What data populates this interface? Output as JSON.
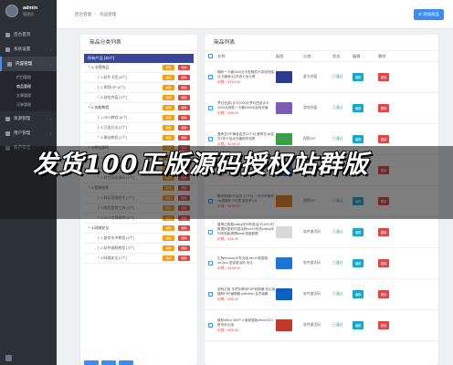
{
  "sidebar": {
    "user": {
      "name": "admin",
      "role": "管理员"
    },
    "items": [
      {
        "label": "后台首页",
        "icon": "home-icon",
        "chev": "",
        "active": false
      },
      {
        "label": "系统设置",
        "icon": "settings-icon",
        "chev": "‹",
        "active": false
      },
      {
        "label": "内容管理",
        "icon": "list-icon",
        "chev": "‹",
        "active": true
      },
      {
        "label": "资源管理",
        "icon": "folder-icon",
        "chev": "‹",
        "active": false
      },
      {
        "label": "用户管理",
        "icon": "user-icon",
        "chev": "‹",
        "active": false
      },
      {
        "label": "账户安全",
        "icon": "shield-icon",
        "chev": "‹",
        "active": false
      }
    ],
    "subitems": [
      "栏目管理",
      "商品管理",
      "文章管理",
      "订单管理"
    ]
  },
  "topbar": {
    "crumbs": [
      "后台管理",
      "/",
      "商品管理"
    ],
    "button": "添加商品"
  },
  "left_panel": {
    "title": "商品分类列表",
    "header": "所有产品 [45个]",
    "edit_label": "编辑",
    "delete_label": "删除",
    "rows": [
      {
        "name": "└ 1.卡密商品",
        "level": 1
      },
      {
        "name": "├ 1.软件卡密 [8个]",
        "level": 2
      },
      {
        "name": "├ 2.视频VIP [4个]",
        "level": 2
      },
      {
        "name": "└ 3.游戏充值 [3个]",
        "level": 2
      },
      {
        "name": "└ 2.技能教程",
        "level": 1
      },
      {
        "name": "├ 1.SEO教程 [6个]",
        "level": 2
      },
      {
        "name": "├ 2.引流方法 [5个]",
        "level": 2
      },
      {
        "name": "└ 3.建站教程 [4个]",
        "level": 2
      },
      {
        "name": "└ 3.网站源码",
        "level": 1
      },
      {
        "name": "├ 1.企业网站源码 [5个]",
        "level": 2
      },
      {
        "name": "├ 2.商城网站源码 [3个]",
        "level": 2
      },
      {
        "name": "└ 3.其它网站源码 [2个]",
        "level": 2
      },
      {
        "name": "└ 3.营销软件",
        "level": 1
      },
      {
        "name": "├ 1.群发营销软件 [4个]",
        "level": 2
      },
      {
        "name": "├ 2.微信营销工具 [3个]",
        "level": 2
      },
      {
        "name": "└ 3.SEO工具软件 [2个]",
        "level": 2
      },
      {
        "name": "└ 4.网络安全",
        "level": 1
      },
      {
        "name": "├ 1.查杀技术教程 [4个]",
        "level": 2
      },
      {
        "name": "├ 2.软件破解教程 [3个]",
        "level": 2
      },
      {
        "name": "└ 3.网络安全 [2个]",
        "level": 2
      }
    ]
  },
  "right_panel": {
    "title": "商品列表",
    "columns": [
      "",
      "名称",
      "配图",
      "分类",
      "状态",
      "编辑",
      "删除"
    ],
    "edit_label": "编辑",
    "delete_label": "删除",
    "rows": [
      {
        "title": "随机一卡通1000元卡密随机卡游戏充值点卡通用QQ币游卡永久等",
        "price": "价格：¥910.00",
        "category": "虚卡充值",
        "status": "已通过",
        "thumb": "#2c3b8f"
      },
      {
        "title": "梦幻西游2点卡1000元梦幻西游点卡1000点网易一卡通1000元游戏充值",
        "price": "价格：¥98.00",
        "category": "游戏充值",
        "status": "已通过",
        "thumb": "#7b5bb5"
      },
      {
        "title": "爱奇艺VIP黄金会员12个月 爱奇艺vip会员1年卡自动充值即时到账",
        "price": "价格：¥148.00",
        "category": "视频VIP",
        "status": "已通过",
        "thumb": "#3b9e4a"
      },
      {
        "title": "优酷视频VIP年卡 优酷VIP会员12个月 自动充值",
        "price": "价格：¥158.00",
        "category": "视频VIP",
        "status": "已通过",
        "thumb": "#2a7ad8"
      },
      {
        "title": "腾讯视频VIP会员 12个月 一年卡好莱坞vip视频年卡年费 直充秒QQ",
        "price": "价格：¥190.00",
        "category": "视频VIP",
        "status": "已通过",
        "thumb": "#e67e22"
      },
      {
        "title": "翼神达数据cdkey序列号激活卡100小时数据恢复软件激活码win10系统cdkey序列号电脑清理stean电脑数据",
        "price": "价格：¥16.00",
        "category": "软件激活码",
        "status": "已通过",
        "thumb": "#d9d9d9"
      },
      {
        "title": "正版window10专业版 win10家庭版 w10pro 密钥激活码 永久",
        "price": "价格：¥198.00",
        "category": "软件激活码",
        "status": "已通过",
        "thumb": "#1e73d6"
      },
      {
        "title": "密码正版 手把手教你PDF转换器 永久版 福昕PDF编辑器 pdfeditor 会员破解",
        "price": "价格：¥36.00",
        "category": "软件激活码",
        "status": "已通过",
        "thumb": "#0e5fc2"
      },
      {
        "title": "微软office 365个人版家庭版office2019账号永久版",
        "price": "价格：¥99.00",
        "category": "软件激活码",
        "status": "已通过",
        "thumb": "#c0392b"
      }
    ]
  },
  "banner": {
    "text": "发货100正版源码授权站群版"
  },
  "colors": {
    "accent": "#3b8cf3",
    "edit": "#f39c12",
    "delete": "#e04646",
    "table_edit": "#1aa6c9",
    "header": "#39469a",
    "sidebar": "#2c3138"
  }
}
